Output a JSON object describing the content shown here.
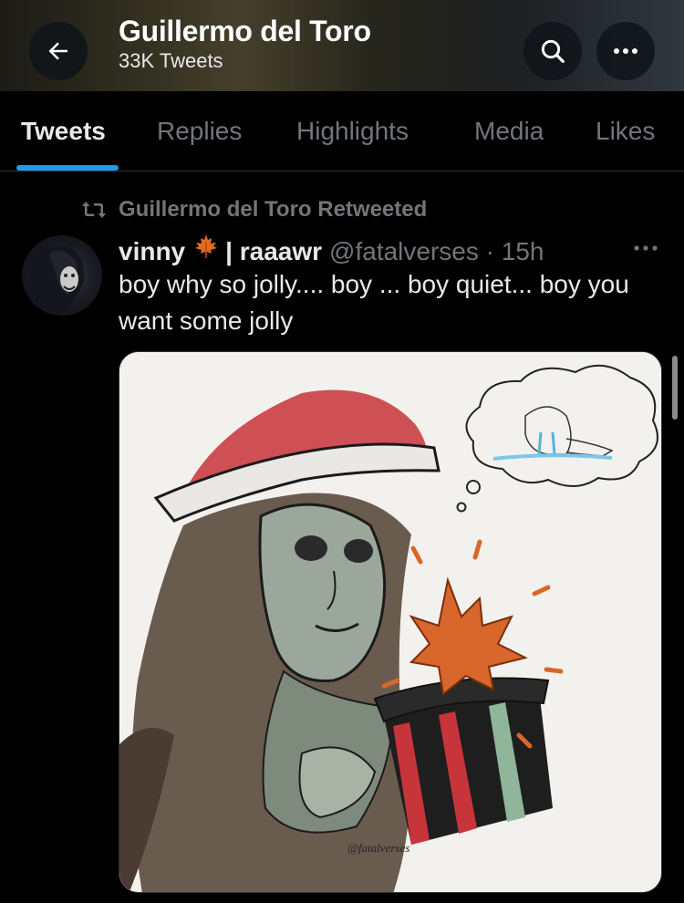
{
  "header": {
    "title": "Guillermo del Toro",
    "subtitle": "33K Tweets"
  },
  "tabs": [
    {
      "label": "Tweets",
      "active": true
    },
    {
      "label": "Replies",
      "active": false
    },
    {
      "label": "Highlights",
      "active": false
    },
    {
      "label": "Media",
      "active": false
    },
    {
      "label": "Likes",
      "active": false
    }
  ],
  "tweet": {
    "retweet_label": "Guillermo del Toro Retweeted",
    "display_name": "vinny",
    "display_name_suffix": "| raaawr",
    "handle_time": "@fatalverses · 15h",
    "text": "boy why so jolly.... boy ... boy quiet... boy you want some jolly",
    "signature": "@fatalverses"
  },
  "colors": {
    "accent": "#1d9bf0",
    "muted": "#71767b",
    "text": "#e7e9ea",
    "background": "#000000"
  },
  "icons": {
    "back": "arrow-left-icon",
    "search": "search-icon",
    "more": "more-horizontal-icon",
    "retweet": "retweet-icon",
    "name_emoji": "maple-leaf-icon"
  }
}
